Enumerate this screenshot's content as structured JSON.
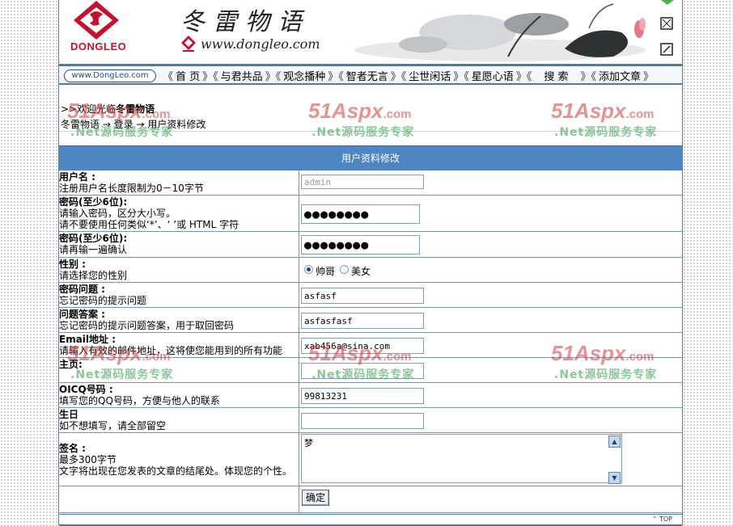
{
  "header": {
    "logo_text": "DONGLEO",
    "site_title": "冬雷物语",
    "site_url": "www.dongleo.com"
  },
  "nav": {
    "pill_text": "www.DongLeo.com",
    "items": [
      "首 页",
      "与君共品",
      "观念播种",
      "智者无言",
      "尘世闲话",
      "星愿心语",
      "搜 索",
      "添加文章"
    ],
    "separator": "》《"
  },
  "welcome": {
    "prefix": ">>欢迎光临",
    "site": "冬雷物语"
  },
  "breadcrumb": {
    "text": "冬雷物语 → 登录 → 用户资料修改"
  },
  "form": {
    "title": "用户资料修改",
    "fields": {
      "username": {
        "label": "用户名 :",
        "hint": "注册用户名长度限制为0－10字节",
        "value": "admin"
      },
      "password": {
        "label": "密码(至少6位):",
        "hint1": "请输入密码，区分大小写。",
        "hint2": "请不要使用任何类似‘*’、‘ ’或 HTML 字符",
        "value": "●●●●●●●●"
      },
      "password_confirm": {
        "label": "密码(至少6位):",
        "hint": "请再输一遍确认",
        "value": "●●●●●●●●"
      },
      "gender": {
        "label": "性别 :",
        "hint": "请选择您的性别",
        "options": [
          "帅哥",
          "美女"
        ],
        "selected": "帅哥"
      },
      "question": {
        "label": "密码问题 :",
        "hint": "忘记密码的提示问题",
        "value": "asfasf"
      },
      "answer": {
        "label": "问题答案 :",
        "hint": "忘记密码的提示问题答案，用于取回密码",
        "value": "asfasfasf"
      },
      "email": {
        "label": "Email地址 :",
        "hint": "请输入有效的邮件地址，这将使您能用到的所有功能",
        "value": "xab456a@sina.com"
      },
      "homepage": {
        "label": "主页:",
        "value": ""
      },
      "oicq": {
        "label": "OICQ号码 :",
        "hint": "填写您的QQ号码，方便与他人的联系",
        "value": "99813231"
      },
      "birthday": {
        "label": "生日",
        "hint": "如不想填写，请全部留空",
        "value": ""
      },
      "signature": {
        "label": "签名 :",
        "hint1": "最多300字节",
        "hint2": "文字将出现在您发表的文章的结尾处。体现您的个性。",
        "value": "梦"
      }
    },
    "submit_label": "确定"
  },
  "footer": {
    "top_label": "TOP"
  },
  "watermark": {
    "brand": "51Aspx",
    "domain": ".com",
    "tagline": ".Net源码服务专家"
  },
  "colors": {
    "accent": "#4d86c2",
    "border": "#7a94b0",
    "logo_red": "#c8102e"
  }
}
